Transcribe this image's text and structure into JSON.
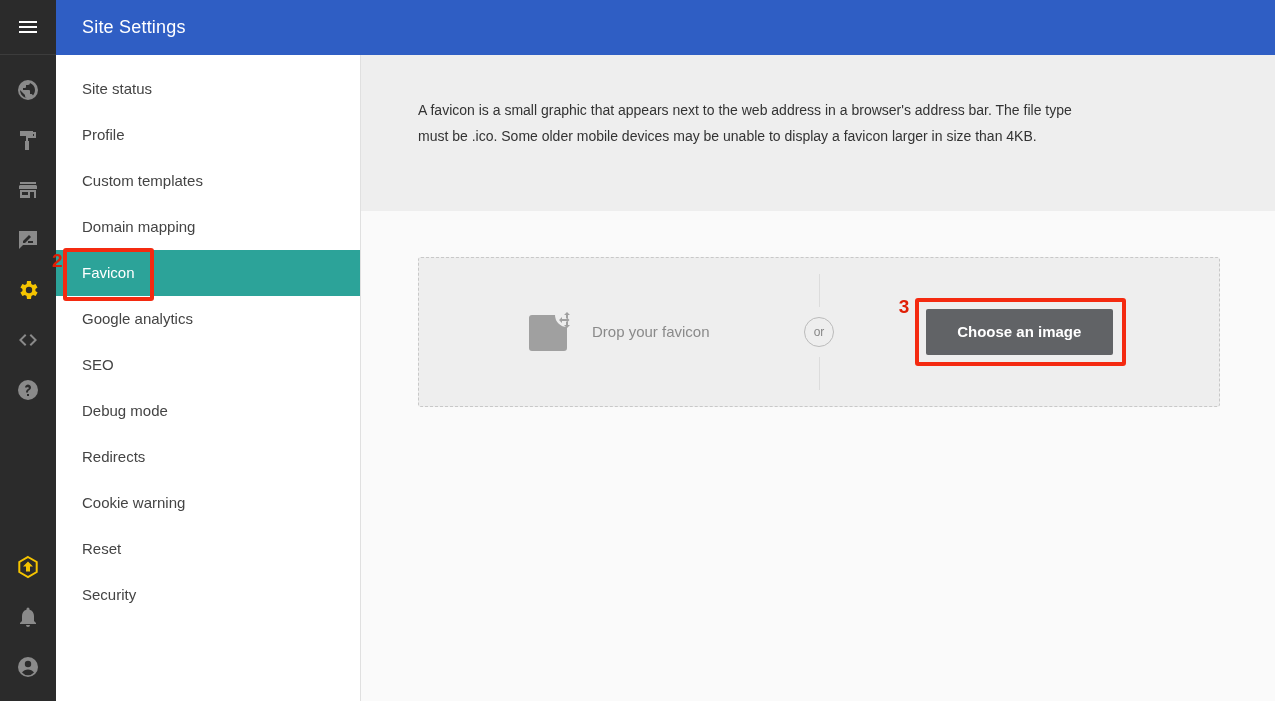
{
  "header": {
    "title": "Site Settings"
  },
  "rail": {
    "items": [
      {
        "kind": "globe",
        "selected": false
      },
      {
        "kind": "roller",
        "selected": false
      },
      {
        "kind": "store",
        "selected": false
      },
      {
        "kind": "feedback",
        "selected": false
      },
      {
        "kind": "gear",
        "selected": true
      },
      {
        "kind": "code",
        "selected": false
      },
      {
        "kind": "help",
        "selected": false
      }
    ],
    "bottom": [
      {
        "kind": "upgrade"
      },
      {
        "kind": "bell"
      },
      {
        "kind": "account"
      }
    ]
  },
  "sidebar": {
    "items": [
      {
        "label": "Site status",
        "selected": false
      },
      {
        "label": "Profile",
        "selected": false
      },
      {
        "label": "Custom templates",
        "selected": false
      },
      {
        "label": "Domain mapping",
        "selected": false
      },
      {
        "label": "Favicon",
        "selected": true,
        "callout": "2"
      },
      {
        "label": "Google analytics",
        "selected": false
      },
      {
        "label": "SEO",
        "selected": false
      },
      {
        "label": "Debug mode",
        "selected": false
      },
      {
        "label": "Redirects",
        "selected": false
      },
      {
        "label": "Cookie warning",
        "selected": false
      },
      {
        "label": "Reset",
        "selected": false
      },
      {
        "label": "Security",
        "selected": false
      }
    ]
  },
  "info": "A favicon is a small graphic that appears next to the web address in a browser's address bar. The file type must be .ico. Some older mobile devices may be unable to display a favicon larger in size than 4KB.",
  "dropzone": {
    "hint": "Drop your favicon",
    "separator": "or",
    "button": {
      "label": "Choose an image",
      "callout": "3"
    }
  }
}
